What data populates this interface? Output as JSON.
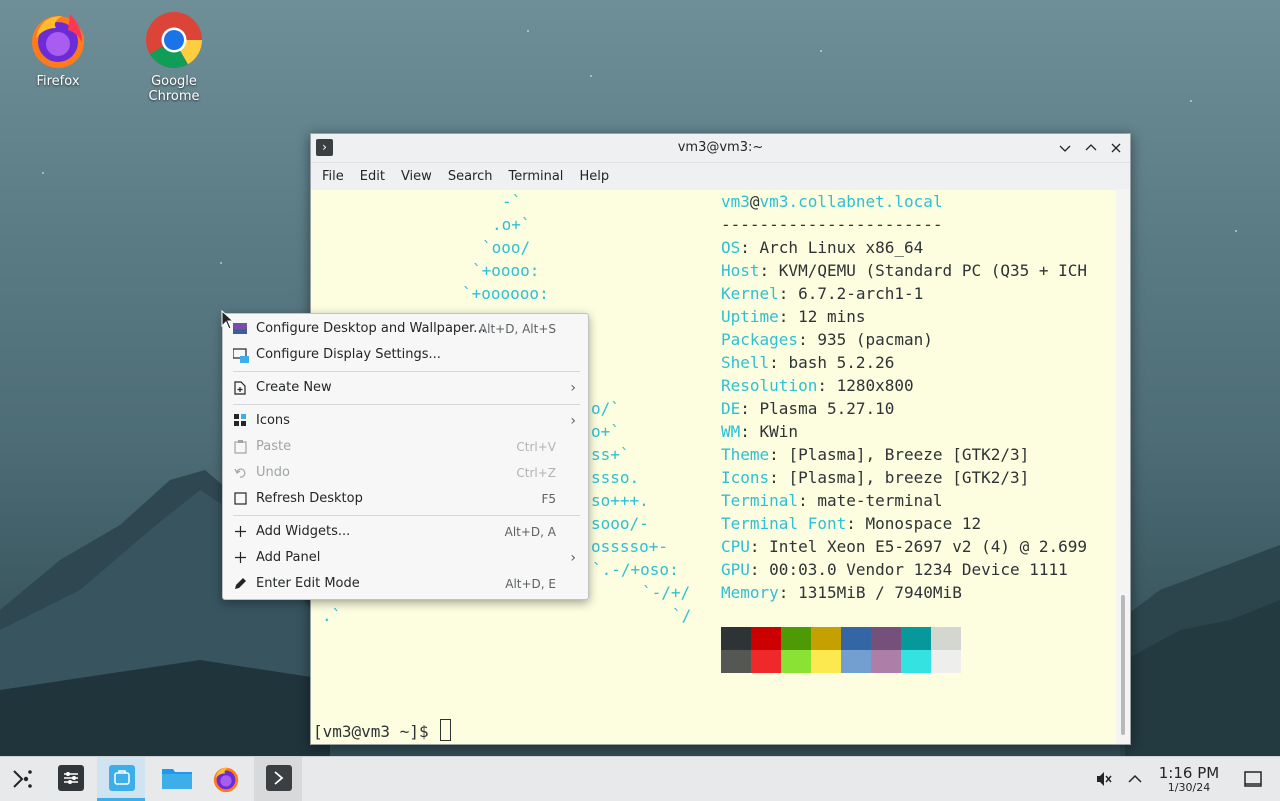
{
  "desktop": {
    "icons": [
      {
        "label": "Firefox"
      },
      {
        "label": "Google Chrome"
      }
    ]
  },
  "terminal": {
    "title": "vm3@vm3:~",
    "menu": [
      "File",
      "Edit",
      "View",
      "Search",
      "Terminal",
      "Help"
    ],
    "logo_lines": [
      "-`",
      ".o+`",
      "`ooo/",
      "`+oooo:",
      "`+oooooo:",
      "o/`",
      "o+`",
      "ss+`",
      "ssso.",
      "so+++.",
      "sooo/-",
      "osssso+-",
      "`.-/+oso:",
      "`-/+/",
      "`/",
      ".`"
    ],
    "userhost": {
      "user": "vm3",
      "at": "@",
      "host": "vm3.collabnet.local"
    },
    "separator": "-----------------------",
    "info": [
      {
        "key": "OS",
        "value": "Arch Linux x86_64"
      },
      {
        "key": "Host",
        "value": "KVM/QEMU (Standard PC (Q35 + ICH"
      },
      {
        "key": "Kernel",
        "value": "6.7.2-arch1-1"
      },
      {
        "key": "Uptime",
        "value": "12 mins"
      },
      {
        "key": "Packages",
        "value": "935 (pacman)"
      },
      {
        "key": "Shell",
        "value": "bash 5.2.26"
      },
      {
        "key": "Resolution",
        "value": "1280x800"
      },
      {
        "key": "DE",
        "value": "Plasma 5.27.10"
      },
      {
        "key": "WM",
        "value": "KWin"
      },
      {
        "key": "Theme",
        "value": "[Plasma], Breeze [GTK2/3]"
      },
      {
        "key": "Icons",
        "value": "[Plasma], breeze [GTK2/3]"
      },
      {
        "key": "Terminal",
        "value": "mate-terminal"
      },
      {
        "key": "Terminal Font",
        "value": "Monospace 12"
      },
      {
        "key": "CPU",
        "value": "Intel Xeon E5-2697 v2 (4) @ 2.699"
      },
      {
        "key": "GPU",
        "value": "00:03.0 Vendor 1234 Device 1111"
      },
      {
        "key": "Memory",
        "value": "1315MiB / 7940MiB"
      }
    ],
    "palette_top": [
      "#2e3436",
      "#cc0000",
      "#4e9a06",
      "#c4a000",
      "#3465a4",
      "#75507b",
      "#06989a",
      "#d3d7cf"
    ],
    "palette_bottom": [
      "#555753",
      "#ef2929",
      "#8ae234",
      "#fce94f",
      "#729fcf",
      "#ad7fa8",
      "#34e2e2",
      "#eeeeec"
    ],
    "prompt": "[vm3@vm3 ~]$ "
  },
  "context_menu": {
    "items": [
      {
        "label": "Configure Desktop and Wallpaper...",
        "shortcut": "Alt+D, Alt+S",
        "icon": "wallpaper-icon"
      },
      {
        "label": "Configure Display Settings...",
        "shortcut": "",
        "icon": "display-icon"
      },
      {
        "label": "Create New",
        "shortcut": "",
        "icon": "new-file-icon",
        "submenu": true
      },
      {
        "label": "Icons",
        "shortcut": "",
        "icon": "grid-icon",
        "submenu": true
      },
      {
        "label": "Paste",
        "shortcut": "Ctrl+V",
        "icon": "paste-icon",
        "disabled": true
      },
      {
        "label": "Undo",
        "shortcut": "Ctrl+Z",
        "icon": "undo-icon",
        "disabled": true
      },
      {
        "label": "Refresh Desktop",
        "shortcut": "F5",
        "icon": "refresh-icon"
      },
      {
        "label": "Add Widgets...",
        "shortcut": "Alt+D, A",
        "icon": "plus-icon"
      },
      {
        "label": "Add Panel",
        "shortcut": "",
        "icon": "plus-icon",
        "submenu": true
      },
      {
        "label": "Enter Edit Mode",
        "shortcut": "Alt+D, E",
        "icon": "pencil-icon"
      }
    ]
  },
  "taskbar": {
    "clock_time": "1:16 PM",
    "clock_date": "1/30/24"
  },
  "colors": {
    "terminal_bg": "#fdfde0",
    "accent_cyan": "#2ec0d4",
    "panel_bg": "#e8e9ea"
  }
}
